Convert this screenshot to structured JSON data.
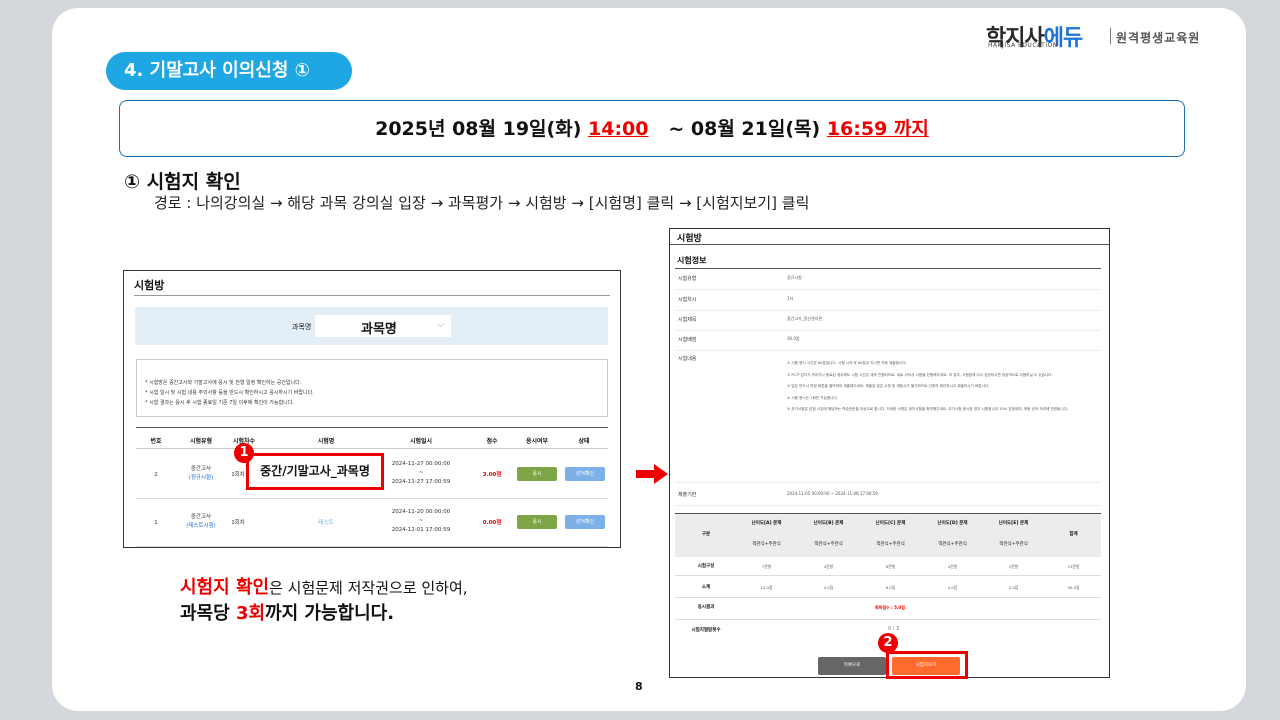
{
  "brand": {
    "main_prefix": "학지사",
    "main_suffix": "에듀",
    "sub": "HAKJISA EDUCATION",
    "right": "원격평생교육원",
    "accent_color": "#1a73d9"
  },
  "header": {
    "pill": "4. 기말고사 이의신청 ①",
    "pill_color": "#1ea7e2"
  },
  "period": {
    "start_date": "2025년 08월 19일(화)",
    "start_time": "14:00",
    "separator": "~",
    "end_date": "08월 21일(목)",
    "end_time": "16:59 까지"
  },
  "section": {
    "title": "① 시험지 확인",
    "route": "경로 : 나의강의실 → 해당 과목 강의실 입장 → 과목평가 → 시험방 →  [시험명] 클릭 → [시험지보기] 클릭"
  },
  "left_screen": {
    "title": "시험방",
    "filter_label": "과목명",
    "filter_value": "과목명",
    "notice": [
      "* 시험방은 중간고사와 기말고사에 응시 및 전형 일정 확인하는 공간입니다.",
      "* 시험 일시 및 시험 내용 주의사항 등을 반드시 확인하시고 응시하시기 바랍니다.",
      "* 시험 결과는 응시 후 시험 종료일 기준 7일 이후에 확인이 가능합니다."
    ],
    "columns": [
      "번호",
      "시험유형",
      "시험차수",
      "시험명",
      "시험일시",
      "점수",
      "응시여부",
      "상태"
    ],
    "rows": [
      {
        "no": "2",
        "type": "중간고사",
        "type_sub": "(정규시험)",
        "round": "1회차",
        "name": "중간/기말고사_과목명",
        "start": "2024-11-27 00:00:00",
        "dash": "~",
        "end": "2024-11-27 17:00:59",
        "score": "3.00점",
        "take": "응시",
        "status": "성적확인"
      },
      {
        "no": "1",
        "type": "중간고사",
        "type_sub": "(테스트시험)",
        "round": "1회차",
        "name": "테스트",
        "start": "2024-11-20 00:00:00",
        "dash": "~",
        "end": "2024-12-01 17:00:59",
        "score": "0.00점",
        "take": "응시",
        "status": "성적확인"
      }
    ],
    "badge": "1"
  },
  "notes": {
    "line1_highlight": "시험지 확인",
    "line1_rest": "은 시험문제 저작권으로 인하여,",
    "line2_prefix": "과목당 ",
    "line2_highlight": "3회",
    "line2_suffix": "까지 가능합니다."
  },
  "right_screen": {
    "title": "시험방",
    "subtitle": "시험정보",
    "info": [
      {
        "label": "시험유형",
        "value": "정규시험"
      },
      {
        "label": "시험차시",
        "value": "1차"
      },
      {
        "label": "시험제목",
        "value": "중간고사_정산관리론"
      },
      {
        "label": "시험배점",
        "value": "30.0점"
      }
    ],
    "content_label": "시험내용",
    "content_lines": [
      "① 시험 응시 시간은 60분입니다. 시험 시작 후 60분이 지나면 자동 제출됩니다.",
      "② PC가 갑자기 꺼지거나 종료된 경우에도 시험 시간은 계속 진행되므로, 새로 이어서 시험을 진행해주세요. 이 경우, 시험창에 다시 입장하시면 정상적으로 이용하실 수 있습니다.",
      "③ 답은 반드시 저장 버튼을 클릭하여 제출해주세요. 제출된 답은 수정 및 재응시가 불가하므로 신중히 확인하시고 제출하시기 바랍니다.",
      "④ 시험 응시는 1회만 가능합니다.",
      "⑤ 추가시험은 감점 사유에 해당하는 학습권한을 대상으로 합니다. 자세한 사항은 공지사항을 확인해주세요. 추가시험 응시한 경우 시험점수의 10% 감점되며, 최종 성적 처리에 반영됩니다."
    ],
    "deadline_label": "제출기한",
    "deadline_value": "2024-11-05 00:00:00 ~ 2024-11-08 17:00:59",
    "table_headers": [
      "구분",
      "난이도[A] 문제",
      "난이도[B] 문제",
      "난이도[C] 문제",
      "난이도[D] 문제",
      "난이도[E] 문제",
      "합계"
    ],
    "table_subheader": "객관식+주관식",
    "rows": [
      {
        "label": "시험구성",
        "values": [
          "7문항",
          "4문항",
          "6문항",
          "4문항",
          "2문항",
          "23문항"
        ]
      },
      {
        "label": "소계",
        "values": [
          "12.0점",
          "4.0점",
          "8.0점",
          "4.0점",
          "2.0점",
          "30.0점"
        ]
      }
    ],
    "result_label": "응시결과",
    "result_value": "획득점수 : 5.0점",
    "count_label": "시험지열람횟수",
    "count_value": "0 / 3",
    "btn_list": "목록으로",
    "btn_view": "시험지보기",
    "badge": "2"
  },
  "page_number": "8"
}
